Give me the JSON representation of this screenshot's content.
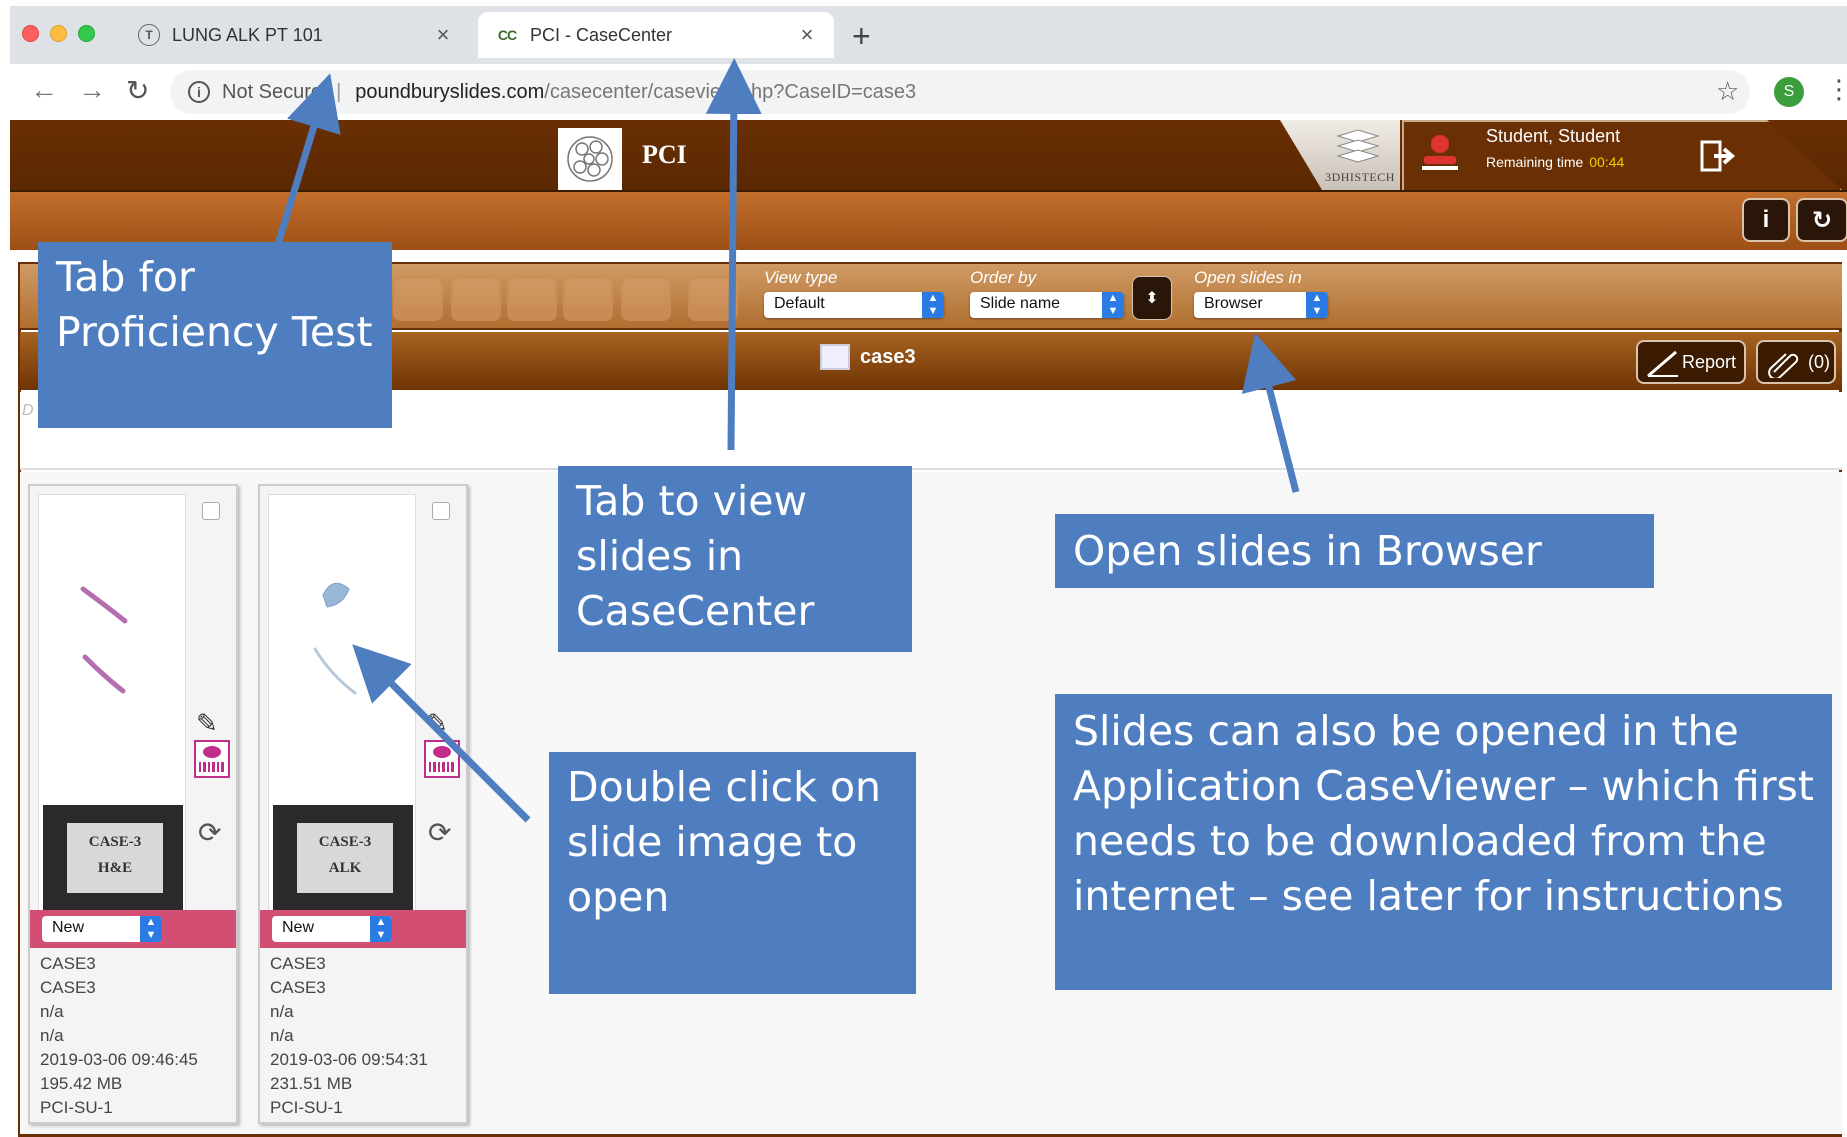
{
  "browser": {
    "tabs": [
      {
        "title": "LUNG ALK PT 101",
        "favicon": "T"
      },
      {
        "title": "PCI - CaseCenter",
        "favicon": "CC",
        "active": true
      }
    ],
    "new_tab": "+",
    "tab_close": "×",
    "not_secure": "Not Secure",
    "url_host": "poundburyslides.com",
    "url_path": "/casecenter/caseview.php?CaseID=case3",
    "profile_initial": "S"
  },
  "app": {
    "title": "PCI",
    "brand": "3DHISTECH",
    "user_name": "Student, Student",
    "remaining_label": "Remaining time",
    "remaining_time": "00:44"
  },
  "controls": {
    "view_type_label": "View type",
    "view_type_value": "Default",
    "order_by_label": "Order by",
    "order_by_value": "Slide name",
    "open_in_label": "Open slides in",
    "open_in_value": "Browser"
  },
  "case": {
    "title": "case3",
    "report_label": "Report",
    "attachments_label": "(0)",
    "desc_fragment": "D"
  },
  "slides": [
    {
      "label_line1": "CASE-3",
      "label_line2": "H&E",
      "status": "New",
      "meta": [
        "CASE3",
        "CASE3",
        "n/a",
        "n/a",
        "2019-03-06 09:46:45",
        "195.42 MB",
        "PCI-SU-1"
      ]
    },
    {
      "label_line1": "CASE-3",
      "label_line2": "ALK",
      "status": "New",
      "meta": [
        "CASE3",
        "CASE3",
        "n/a",
        "n/a",
        "2019-03-06 09:54:31",
        "231.51 MB",
        "PCI-SU-1"
      ]
    }
  ],
  "annotations": {
    "proficiency_tab": "Tab for Proficiency Test",
    "casecenter_tab": "Tab to view slides in CaseCenter",
    "open_browser": "Open slides in Browser",
    "double_click": "Double click on slide image to open",
    "caseviewer": "Slides can also be opened in the Application CaseViewer – which first needs to be downloaded from the internet – see later for instructions"
  },
  "colors": {
    "header_brown": "#6a2f04",
    "toolbar_orange": "#c26f2d",
    "callout_blue": "#4f7ec0",
    "status_pink": "#d24e73",
    "select_blue": "#2a7be4"
  },
  "icons": [
    "back-arrow-icon",
    "forward-arrow-icon",
    "reload-icon",
    "info-icon",
    "star-icon",
    "kebab-menu-icon",
    "user-icon",
    "logout-icon",
    "info-icon",
    "refresh-icon",
    "report-icon",
    "paperclip-icon",
    "edit-pencil-icon",
    "barcode-icon",
    "rotate-icon"
  ]
}
